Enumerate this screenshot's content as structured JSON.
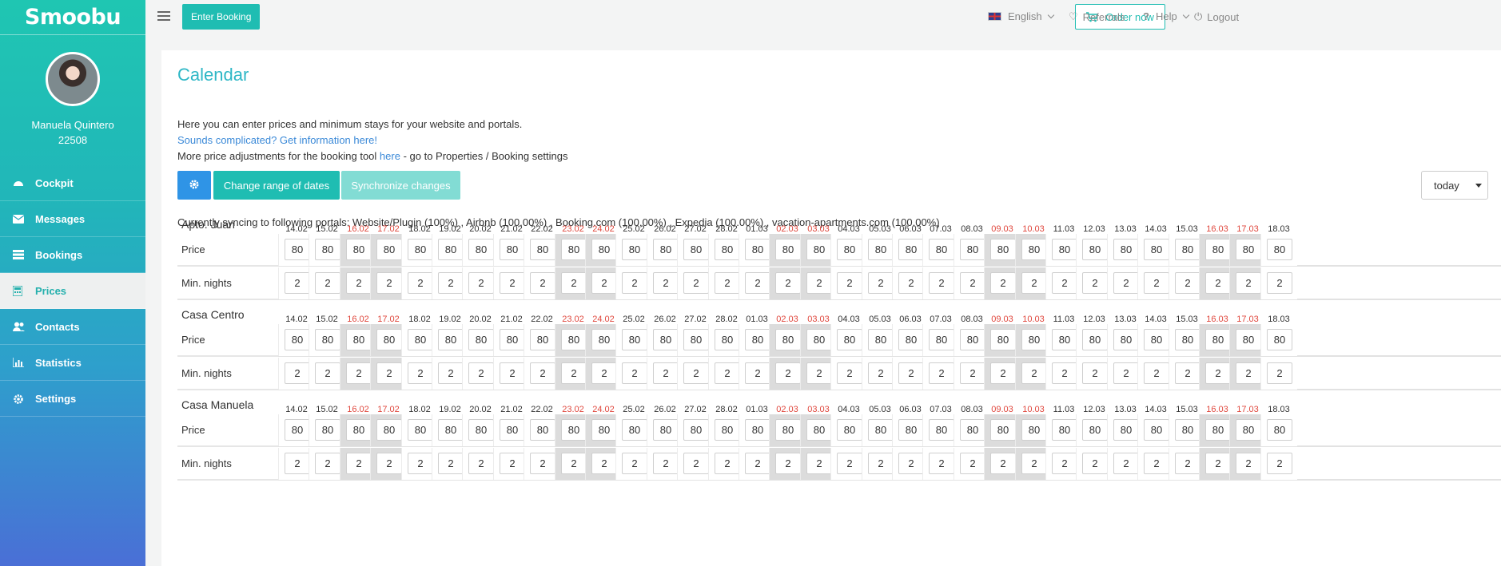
{
  "brand": {
    "logo": "Smoobu",
    "accent": "#1fbdb2"
  },
  "topbar": {
    "enter_booking": "Enter Booking",
    "order_now": "Order now",
    "language": "English",
    "referrals": "Referrals",
    "help": "Help",
    "logout": "Logout"
  },
  "user": {
    "name": "Manuela Quintero",
    "id": "22508"
  },
  "nav": [
    {
      "label": "Cockpit",
      "icon": "dashboard-icon",
      "active": false
    },
    {
      "label": "Messages",
      "icon": "envelope-icon",
      "active": false
    },
    {
      "label": "Bookings",
      "icon": "list-icon",
      "active": false
    },
    {
      "label": "Prices",
      "icon": "calculator-icon",
      "active": true
    },
    {
      "label": "Contacts",
      "icon": "users-icon",
      "active": false
    },
    {
      "label": "Statistics",
      "icon": "bar-chart-icon",
      "active": false
    },
    {
      "label": "Settings",
      "icon": "gear-icon",
      "active": false
    }
  ],
  "page": {
    "title": "Calendar",
    "intro_line1": "Here you can enter prices and minimum stays for your website and portals.",
    "intro_link": "Sounds complicated? Get information here!",
    "intro_line3_prefix": "More price adjustments for the booking tool ",
    "intro_line3_link": "here",
    "intro_line3_suffix": " - go to Properties / Booking settings",
    "change_range": "Change range of dates",
    "synchronize": "Synchronize changes",
    "today_select": "today",
    "sync_status": "Currently syncing to following portals: Website/Plugin (100%) , Airbnb (100.00%) , Booking.com (100.00%) , Expedia (100.00%) , vacation-apartments.com (100.00%)"
  },
  "row_labels": {
    "price": "Price",
    "min_nights": "Min. nights"
  },
  "dates": [
    {
      "label": "14.02",
      "weekend": false,
      "gray": false
    },
    {
      "label": "15.02",
      "weekend": false,
      "gray": false
    },
    {
      "label": "16.02",
      "weekend": true,
      "gray": true
    },
    {
      "label": "17.02",
      "weekend": true,
      "gray": true
    },
    {
      "label": "18.02",
      "weekend": false,
      "gray": false
    },
    {
      "label": "19.02",
      "weekend": false,
      "gray": false
    },
    {
      "label": "20.02",
      "weekend": false,
      "gray": false
    },
    {
      "label": "21.02",
      "weekend": false,
      "gray": false
    },
    {
      "label": "22.02",
      "weekend": false,
      "gray": false
    },
    {
      "label": "23.02",
      "weekend": true,
      "gray": true
    },
    {
      "label": "24.02",
      "weekend": true,
      "gray": true
    },
    {
      "label": "25.02",
      "weekend": false,
      "gray": false
    },
    {
      "label": "26.02",
      "weekend": false,
      "gray": false
    },
    {
      "label": "27.02",
      "weekend": false,
      "gray": false
    },
    {
      "label": "28.02",
      "weekend": false,
      "gray": false
    },
    {
      "label": "01.03",
      "weekend": false,
      "gray": false
    },
    {
      "label": "02.03",
      "weekend": true,
      "gray": true
    },
    {
      "label": "03.03",
      "weekend": true,
      "gray": true
    },
    {
      "label": "04.03",
      "weekend": false,
      "gray": false
    },
    {
      "label": "05.03",
      "weekend": false,
      "gray": false
    },
    {
      "label": "06.03",
      "weekend": false,
      "gray": false
    },
    {
      "label": "07.03",
      "weekend": false,
      "gray": false
    },
    {
      "label": "08.03",
      "weekend": false,
      "gray": false
    },
    {
      "label": "09.03",
      "weekend": true,
      "gray": true
    },
    {
      "label": "10.03",
      "weekend": true,
      "gray": true
    },
    {
      "label": "11.03",
      "weekend": false,
      "gray": false
    },
    {
      "label": "12.03",
      "weekend": false,
      "gray": false
    },
    {
      "label": "13.03",
      "weekend": false,
      "gray": false
    },
    {
      "label": "14.03",
      "weekend": false,
      "gray": false
    },
    {
      "label": "15.03",
      "weekend": false,
      "gray": false
    },
    {
      "label": "16.03",
      "weekend": true,
      "gray": true
    },
    {
      "label": "17.03",
      "weekend": true,
      "gray": true
    },
    {
      "label": "18.03",
      "weekend": false,
      "gray": false
    }
  ],
  "properties": [
    {
      "name": "Apto. Juan",
      "bars": [
        "red",
        "red",
        "red",
        "red",
        "blue",
        "blue",
        "blue",
        "blue",
        "red",
        "red",
        "red",
        "blue",
        "blue",
        "blue",
        "blue",
        "blue",
        "blue",
        "blue",
        "blue",
        "blue",
        "blue",
        "blue",
        "blue",
        "blue",
        "blue",
        "blue",
        "blue",
        "blue",
        "blue",
        "blue",
        "blue",
        "blue",
        "blue"
      ],
      "prices": [
        "80",
        "80",
        "80",
        "80",
        "80",
        "80",
        "80",
        "80",
        "80",
        "80",
        "80",
        "80",
        "80",
        "80",
        "80",
        "80",
        "80",
        "80",
        "80",
        "80",
        "80",
        "80",
        "80",
        "80",
        "80",
        "80",
        "80",
        "80",
        "80",
        "80",
        "80",
        "80",
        "80"
      ],
      "min_nights": [
        "2",
        "2",
        "2",
        "2",
        "2",
        "2",
        "2",
        "2",
        "2",
        "2",
        "2",
        "2",
        "2",
        "2",
        "2",
        "2",
        "2",
        "2",
        "2",
        "2",
        "2",
        "2",
        "2",
        "2",
        "2",
        "2",
        "2",
        "2",
        "2",
        "2",
        "2",
        "2",
        "2"
      ]
    },
    {
      "name": "Casa Centro",
      "bars": [
        "blue",
        "blue",
        "red",
        "red",
        "red",
        "red",
        "red",
        "red",
        "red",
        "red",
        "red",
        "red",
        "red",
        "red",
        "red",
        "blue",
        "blue",
        "blue",
        "blue",
        "blue",
        "blue",
        "blue",
        "blue",
        "blue",
        "blue",
        "blue",
        "blue",
        "blue",
        "blue",
        "blue",
        "blue",
        "blue",
        "blue"
      ],
      "prices": [
        "80",
        "80",
        "80",
        "80",
        "80",
        "80",
        "80",
        "80",
        "80",
        "80",
        "80",
        "80",
        "80",
        "80",
        "80",
        "80",
        "80",
        "80",
        "80",
        "80",
        "80",
        "80",
        "80",
        "80",
        "80",
        "80",
        "80",
        "80",
        "80",
        "80",
        "80",
        "80",
        "80"
      ],
      "min_nights": [
        "2",
        "2",
        "2",
        "2",
        "2",
        "2",
        "2",
        "2",
        "2",
        "2",
        "2",
        "2",
        "2",
        "2",
        "2",
        "2",
        "2",
        "2",
        "2",
        "2",
        "2",
        "2",
        "2",
        "2",
        "2",
        "2",
        "2",
        "2",
        "2",
        "2",
        "2",
        "2",
        "2"
      ]
    },
    {
      "name": "Casa Manuela",
      "bars": [
        "red",
        "red",
        "red",
        "red",
        "red",
        "red",
        "red",
        "blue",
        "blue",
        "blue",
        "blue",
        "blue",
        "blue",
        "blue",
        "blue",
        "blue",
        "blue",
        "blue",
        "blue",
        "blue",
        "blue",
        "blue",
        "blue",
        "blue",
        "blue",
        "blue",
        "blue",
        "blue",
        "blue",
        "blue",
        "blue",
        "blue",
        "blue"
      ],
      "prices": [
        "80",
        "80",
        "80",
        "80",
        "80",
        "80",
        "80",
        "80",
        "80",
        "80",
        "80",
        "80",
        "80",
        "80",
        "80",
        "80",
        "80",
        "80",
        "80",
        "80",
        "80",
        "80",
        "80",
        "80",
        "80",
        "80",
        "80",
        "80",
        "80",
        "80",
        "80",
        "80",
        "80"
      ],
      "min_nights": [
        "2",
        "2",
        "2",
        "2",
        "2",
        "2",
        "2",
        "2",
        "2",
        "2",
        "2",
        "2",
        "2",
        "2",
        "2",
        "2",
        "2",
        "2",
        "2",
        "2",
        "2",
        "2",
        "2",
        "2",
        "2",
        "2",
        "2",
        "2",
        "2",
        "2",
        "2",
        "2",
        "2"
      ]
    }
  ]
}
